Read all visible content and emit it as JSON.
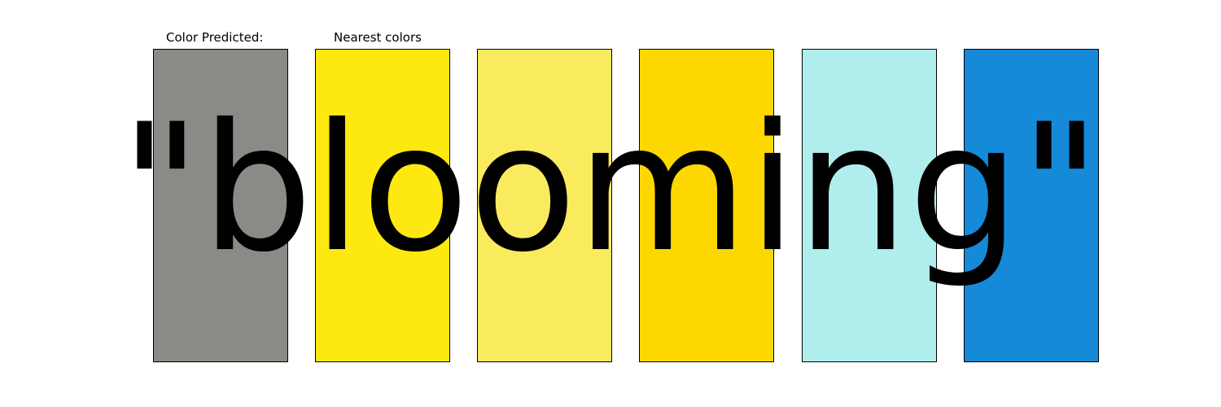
{
  "labels": {
    "predicted": "Color Predicted:",
    "nearest": "Nearest colors"
  },
  "word": "\"blooming\"",
  "swatches": [
    {
      "role": "predicted",
      "color": "#8c8a87"
    },
    {
      "role": "nearest",
      "color": "#fde910"
    },
    {
      "role": "nearest",
      "color": "#faea5e"
    },
    {
      "role": "nearest",
      "color": "#fdd800"
    },
    {
      "role": "nearest",
      "color": "#b0eded"
    },
    {
      "role": "nearest",
      "color": "#148ad9"
    }
  ]
}
